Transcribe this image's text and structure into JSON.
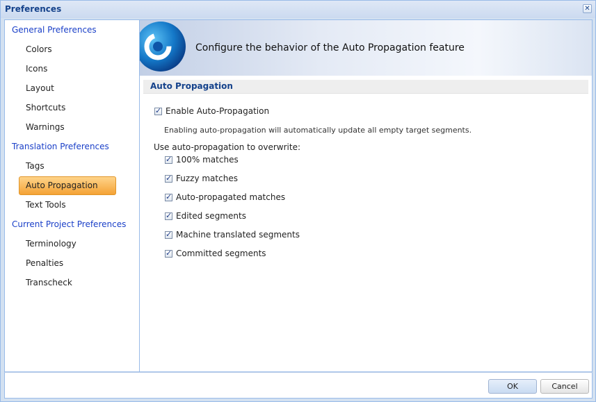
{
  "window": {
    "title": "Preferences",
    "close_icon": "close-icon"
  },
  "sidebar": {
    "groups": [
      {
        "label": "General Preferences",
        "items": [
          "Colors",
          "Icons",
          "Layout",
          "Shortcuts",
          "Warnings"
        ]
      },
      {
        "label": "Translation Preferences",
        "items": [
          "Tags",
          "Auto Propagation",
          "Text Tools"
        ]
      },
      {
        "label": "Current Project Preferences",
        "items": [
          "Terminology",
          "Penalties",
          "Transcheck"
        ]
      }
    ],
    "active": "Auto Propagation"
  },
  "banner": {
    "text": "Configure the behavior of the Auto Propagation feature",
    "logo_icon": "app-logo-icon"
  },
  "section": {
    "title": "Auto Propagation",
    "enable_label": "Enable Auto-Propagation",
    "enable_checked": true,
    "description": "Enabling auto-propagation will automatically update all empty target segments.",
    "overwrite_label": "Use auto-propagation to overwrite:",
    "options": [
      {
        "label": "100% matches",
        "checked": true
      },
      {
        "label": "Fuzzy matches",
        "checked": true
      },
      {
        "label": "Auto-propagated matches",
        "checked": true
      },
      {
        "label": "Edited segments",
        "checked": true
      },
      {
        "label": "Machine translated segments",
        "checked": true
      },
      {
        "label": "Committed segments",
        "checked": true
      }
    ]
  },
  "footer": {
    "ok_label": "OK",
    "cancel_label": "Cancel"
  },
  "colors": {
    "accent": "#15428b",
    "link": "#1b40c8",
    "active_item": "#f4a235"
  }
}
